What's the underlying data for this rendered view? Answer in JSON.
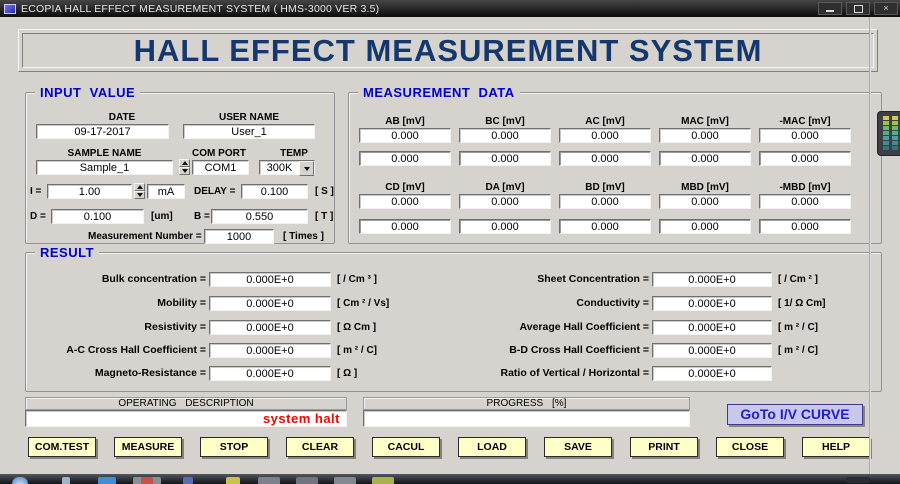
{
  "window": {
    "title": "ECOPIA HALL EFFECT MEASUREMENT SYSTEM ( HMS-3000  VER 3.5)",
    "controls": {
      "close_glyph": "×"
    }
  },
  "header": {
    "title": "HALL EFFECT MEASUREMENT SYSTEM"
  },
  "input_value": {
    "legend": "INPUT VALUE",
    "date": {
      "label": "DATE",
      "value": "09-17-2017"
    },
    "user_name": {
      "label": "USER NAME",
      "value": "User_1"
    },
    "sample_name": {
      "label": "SAMPLE NAME",
      "value": "Sample_1"
    },
    "com_port": {
      "label": "COM PORT",
      "value": "COM1"
    },
    "temp": {
      "label": "TEMP",
      "value": "300K"
    },
    "current": {
      "label": "I =",
      "value": "1.00",
      "unit": "mA"
    },
    "delay": {
      "label": "DELAY =",
      "value": "0.100",
      "unit": "[ S ]"
    },
    "thickness": {
      "label": "D =",
      "value": "0.100",
      "unit": "[um]"
    },
    "magnetic_field": {
      "label": "B =",
      "value": "0.550",
      "unit": "[ T ]"
    },
    "measurement_number": {
      "label": "Measurement Number =",
      "value": "1000",
      "unit": "[ Times ]"
    }
  },
  "measurement_data": {
    "legend": "MEASUREMENT DATA",
    "groups": [
      {
        "columns": [
          "AB [mV]",
          "BC [mV]",
          "AC [mV]",
          "MAC [mV]",
          "-MAC [mV]"
        ],
        "row1": [
          "0.000",
          "0.000",
          "0.000",
          "0.000",
          "0.000"
        ],
        "row2": [
          "0.000",
          "0.000",
          "0.000",
          "0.000",
          "0.000"
        ]
      },
      {
        "columns": [
          "CD [mV]",
          "DA [mV]",
          "BD [mV]",
          "MBD [mV]",
          "-MBD [mV]"
        ],
        "row1": [
          "0.000",
          "0.000",
          "0.000",
          "0.000",
          "0.000"
        ],
        "row2": [
          "0.000",
          "0.000",
          "0.000",
          "0.000",
          "0.000"
        ]
      }
    ]
  },
  "result": {
    "legend": "RESULT",
    "left": [
      {
        "label": "Bulk concentration =",
        "value": "0.000E+0",
        "units": "[ / Cm ³ ]"
      },
      {
        "label": "Mobility =",
        "value": "0.000E+0",
        "units": "[ Cm ² / Vs]"
      },
      {
        "label": "Resistivity =",
        "value": "0.000E+0",
        "units": "[ Ω Cm ]"
      },
      {
        "label": "A-C Cross Hall Coefficient =",
        "value": "0.000E+0",
        "units": "[ m ² / C]"
      },
      {
        "label": "Magneto-Resistance =",
        "value": "0.000E+0",
        "units": "[ Ω ]"
      }
    ],
    "right": [
      {
        "label": "Sheet Concentration =",
        "value": "0.000E+0",
        "units": "[ / Cm ² ]"
      },
      {
        "label": "Conductivity =",
        "value": "0.000E+0",
        "units": "[ 1/ Ω Cm]"
      },
      {
        "label": "Average Hall Coefficient =",
        "value": "0.000E+0",
        "units": "[ m ² / C]"
      },
      {
        "label": "B-D Cross Hall Coefficient =",
        "value": "0.000E+0",
        "units": "[ m ² / C]"
      },
      {
        "label": "Ratio of Vertical / Horizontal =",
        "value": "0.000E+0",
        "units": ""
      }
    ]
  },
  "operating": {
    "header": "OPERATING DESCRIPTION",
    "status": "system halt"
  },
  "progress": {
    "header": "PROGRESS [%]",
    "value": ""
  },
  "goto_curve_label": "GoTo I/V CURVE",
  "action_buttons": [
    "COM.TEST",
    "MEASURE",
    "STOP",
    "CLEAR",
    "CACUL",
    "LOAD",
    "SAVE",
    "PRINT",
    "CLOSE",
    "HELP"
  ],
  "colors": {
    "accent_blue": "#0000cf",
    "title_navy": "#14386e",
    "button_yellow": "#ffffc8",
    "goto_lavender": "#c9c7ee",
    "status_red": "#ff0000"
  }
}
